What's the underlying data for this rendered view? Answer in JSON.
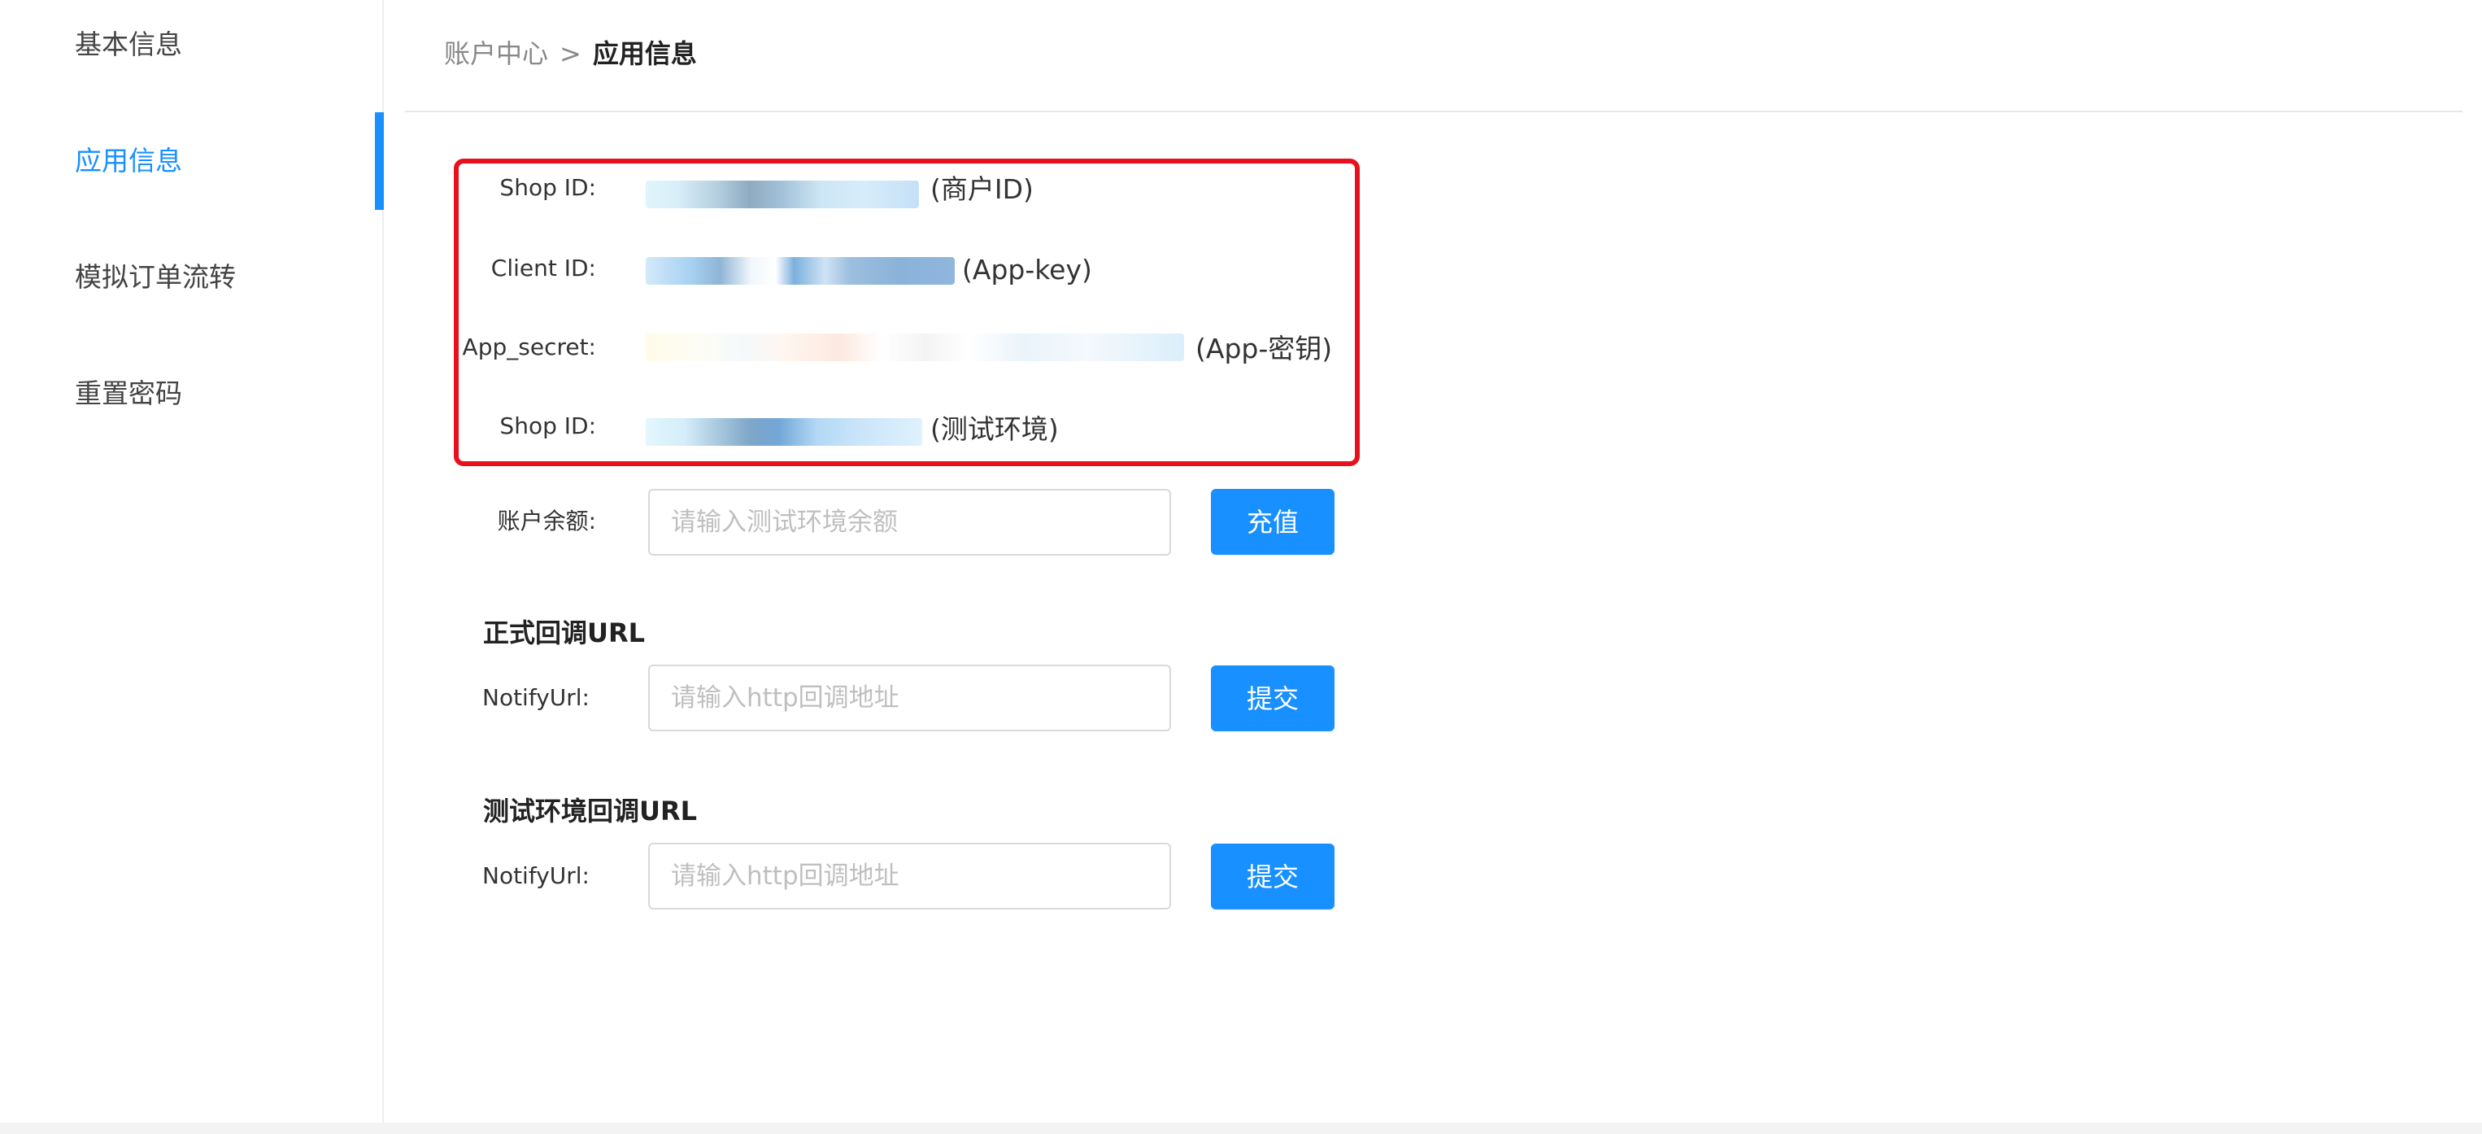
{
  "sidebar": {
    "items": [
      {
        "label": "基本信息"
      },
      {
        "label": "应用信息"
      },
      {
        "label": "模拟订单流转"
      },
      {
        "label": "重置密码"
      }
    ],
    "active_index": 1
  },
  "breadcrumb": {
    "parent": "账户中心",
    "separator": ">",
    "current": "应用信息"
  },
  "credentials": {
    "shop_id_label": "Shop ID:",
    "shop_id_suffix": "(商户ID)",
    "client_id_label": "Client ID:",
    "client_id_suffix": "(App-key)",
    "app_secret_label": "App_secret:",
    "app_secret_suffix": "(App-密钥)",
    "test_shop_id_label": "Shop ID:",
    "test_shop_id_suffix": "(测试环境)"
  },
  "balance": {
    "label": "账户余额:",
    "placeholder": "请输入测试环境余额",
    "button_label": "充值"
  },
  "production_callback": {
    "title": "正式回调URL",
    "label": "NotifyUrl:",
    "placeholder": "请输入http回调地址",
    "button_label": "提交"
  },
  "test_callback": {
    "title": "测试环境回调URL",
    "label": "NotifyUrl:",
    "placeholder": "请输入http回调地址",
    "button_label": "提交"
  },
  "colors": {
    "primary": "#1890ff",
    "highlight_border": "#e8101c"
  }
}
